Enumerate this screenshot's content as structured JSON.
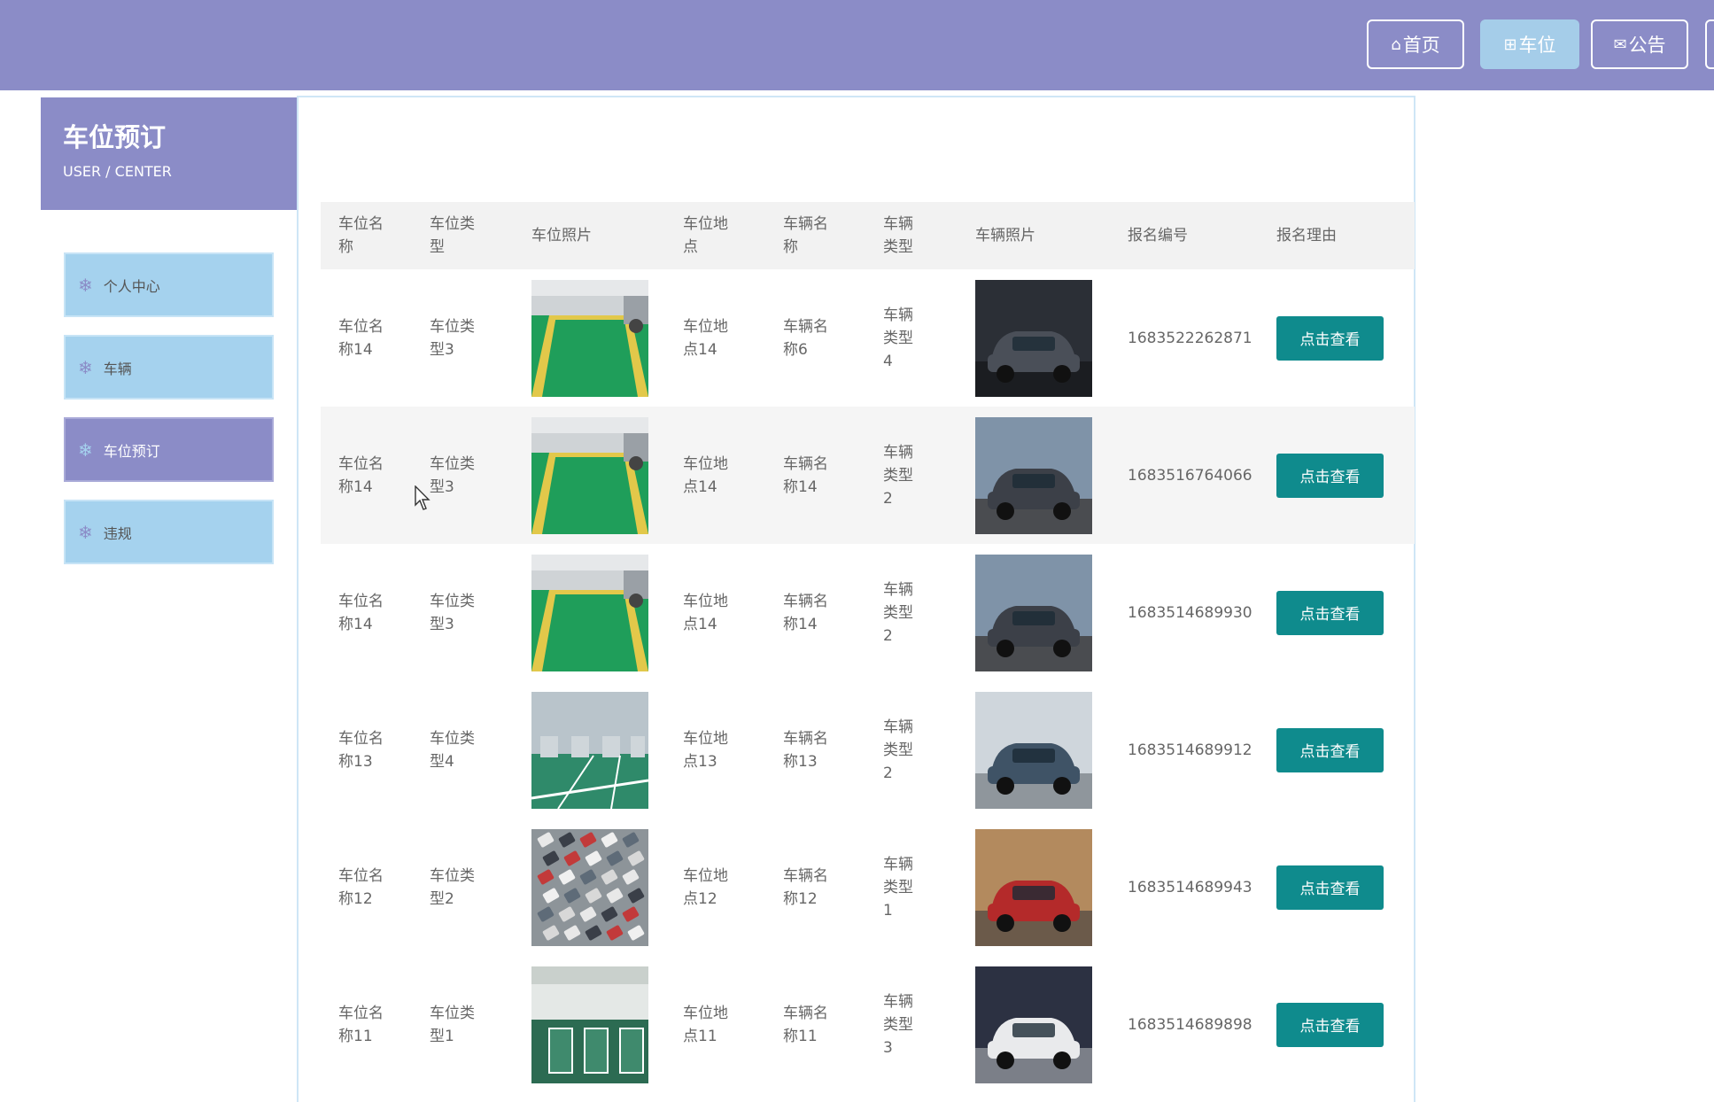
{
  "nav": [
    {
      "icon": "⌂",
      "label": "首页",
      "active": false
    },
    {
      "icon": "⊞",
      "label": "车位",
      "active": true
    },
    {
      "icon": "✉",
      "label": "公告",
      "active": false
    }
  ],
  "sidebar": {
    "title": "车位预订",
    "subtitle": "USER / CENTER",
    "items": [
      {
        "label": "个人中心",
        "active": false
      },
      {
        "label": "车辆",
        "active": false
      },
      {
        "label": "车位预订",
        "active": true
      },
      {
        "label": "违规",
        "active": false
      }
    ]
  },
  "table": {
    "headers": [
      "车位名称",
      "车位类型",
      "车位照片",
      "车位地点",
      "车辆名称",
      "车辆类型",
      "车辆照片",
      "报名编号",
      "报名理由"
    ],
    "button_label": "点击查看",
    "rows": [
      {
        "name": "车位名称14",
        "type": "车位类型3",
        "place": "车位地点14",
        "vname": "车辆名称6",
        "vtype": "车辆类型4",
        "code": "1683522262871",
        "img": "green-lot",
        "car": "dark-suv"
      },
      {
        "name": "车位名称14",
        "type": "车位类型3",
        "place": "车位地点14",
        "vname": "车辆名称14",
        "vtype": "车辆类型2",
        "code": "1683516764066",
        "img": "green-lot",
        "car": "road-suv"
      },
      {
        "name": "车位名称14",
        "type": "车位类型3",
        "place": "车位地点14",
        "vname": "车辆名称14",
        "vtype": "车辆类型2",
        "code": "1683514689930",
        "img": "green-lot",
        "car": "road-suv"
      },
      {
        "name": "车位名称13",
        "type": "车位类型4",
        "place": "车位地点13",
        "vname": "车辆名称13",
        "vtype": "车辆类型2",
        "code": "1683514689912",
        "img": "garage",
        "car": "hatchback"
      },
      {
        "name": "车位名称12",
        "type": "车位类型2",
        "place": "车位地点12",
        "vname": "车辆名称12",
        "vtype": "车辆类型1",
        "code": "1683514689943",
        "img": "aerial-lot",
        "car": "red-sedan"
      },
      {
        "name": "车位名称11",
        "type": "车位类型1",
        "place": "车位地点11",
        "vname": "车辆名称11",
        "vtype": "车辆类型3",
        "code": "1683514689898",
        "img": "indoor-lot",
        "car": "white-coupe"
      }
    ]
  },
  "colors": {
    "header": "#8b8cc7",
    "sidebar_item": "#a5d2ee",
    "button": "#0f8b8d"
  }
}
